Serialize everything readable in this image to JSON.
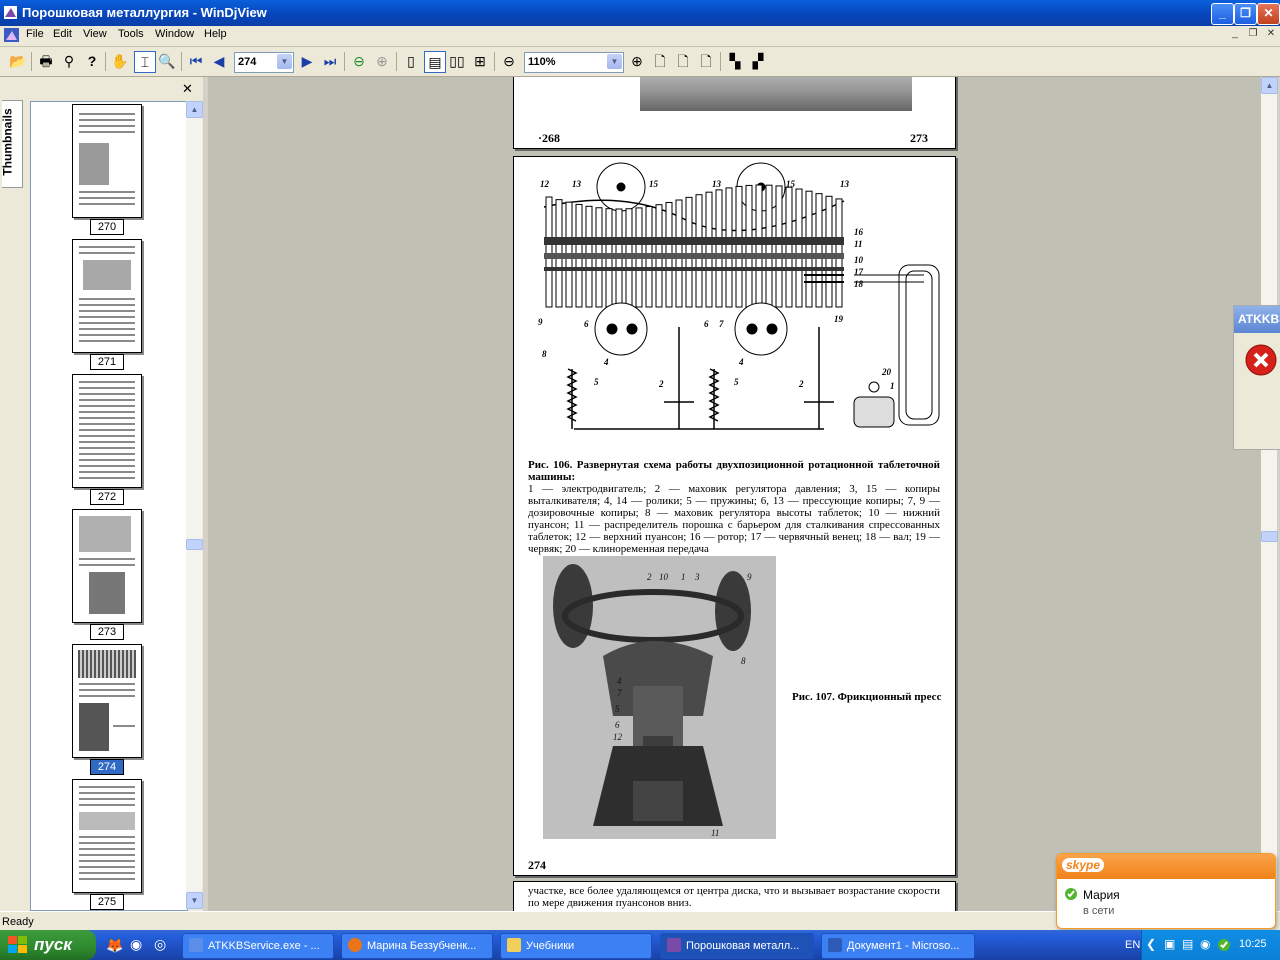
{
  "window": {
    "title": "Порошковая металлургия - WinDjView"
  },
  "menu": [
    "File",
    "Edit",
    "View",
    "Tools",
    "Window",
    "Help"
  ],
  "toolbar": {
    "page_value": "274",
    "zoom_value": "110%"
  },
  "sidebar": {
    "tab_label": "Thumbnails",
    "thumbnails": [
      {
        "label": "270"
      },
      {
        "label": "271"
      },
      {
        "label": "272"
      },
      {
        "label": "273"
      },
      {
        "label": "274",
        "selected": true
      },
      {
        "label": "275"
      }
    ]
  },
  "document": {
    "prev_page": {
      "left_number": "·268",
      "right_number": "273"
    },
    "page": {
      "number": "274",
      "figure106_caption_title": "Рис. 106. Развернутая схема работы двухпозиционной ротационной таблеточной машины:",
      "figure106_legend": "1 — электродвигатель; 2 — маховик регулятора давления; 3, 15 — копиры выталкивателя; 4, 14 — ролики; 5 — пружины; 6, 13 — прессующие копиры; 7, 9 — дозировочные копиры; 8 — маховик регулятора высоты таблеток; 10 — нижний пуансон; 11 — распределитель порошка с барьером для сталкивания спрессованных таблеток; 12 — верхний пуансон; 16 — ротор; 17 — червячный венец; 18 — вал; 19 — червяк; 20 — клиноременная передача",
      "figure107_caption": "Рис. 107. Фрикционный пресс"
    },
    "next_page_text": "участке, все более удаляющемся от центра диска, что и вызывает возрастание скорости по мере движения пуансонов вниз."
  },
  "status": {
    "text": "Ready"
  },
  "taskbar": {
    "start_label": "пуск",
    "tasks": [
      {
        "label": "ATKKBService.exe - ...",
        "icon_color": "#5b8ee6"
      },
      {
        "label": "Марина Беззубченк...",
        "icon_color": "#e8741c"
      },
      {
        "label": "Учебники",
        "icon_color": "#f2cf5b"
      },
      {
        "label": "Порошковая металл...",
        "icon_color": "#7a4aa8",
        "active": true
      },
      {
        "label": "Документ1 - Microso...",
        "icon_color": "#2c5bb8"
      }
    ],
    "lang": "EN",
    "clock": "10:25"
  },
  "atkkb_popup": {
    "title": "ATKKBS"
  },
  "skype_popup": {
    "brand": "skype",
    "contact_name": "Мария",
    "status_text": "в сети"
  }
}
